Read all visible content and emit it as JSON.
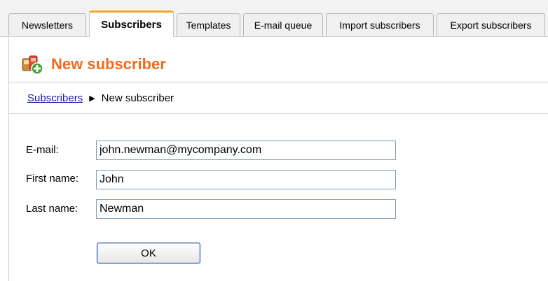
{
  "tabs": [
    {
      "label": "Newsletters"
    },
    {
      "label": "Subscribers"
    },
    {
      "label": "Templates"
    },
    {
      "label": "E-mail queue"
    },
    {
      "label": "Import subscribers"
    },
    {
      "label": "Export subscribers"
    }
  ],
  "active_tab": "Subscribers",
  "page": {
    "title": "New subscriber",
    "icon": "new-subscriber-icon",
    "title_color": "#f26b1d"
  },
  "breadcrumb": {
    "parent": "Subscribers",
    "current": "New subscriber"
  },
  "form": {
    "email_label": "E-mail:",
    "email_value": "john.newman@mycompany.com",
    "first_name_label": "First name:",
    "first_name_value": "John",
    "last_name_label": "Last name:",
    "last_name_value": "Newman",
    "ok_label": "OK"
  }
}
